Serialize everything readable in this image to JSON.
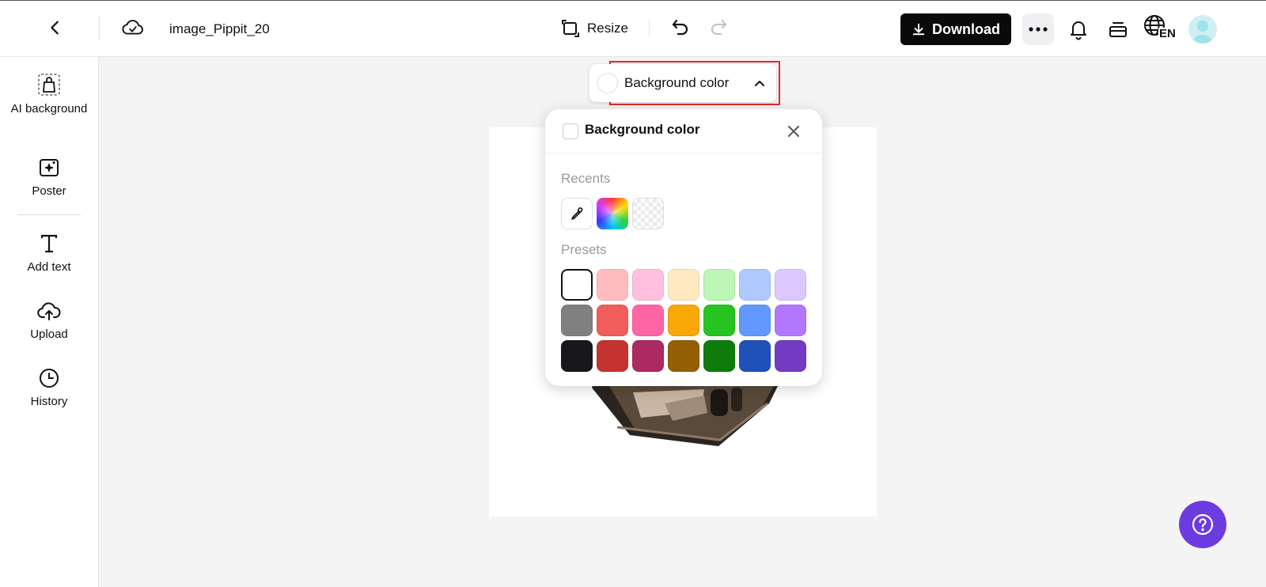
{
  "topbar": {
    "filename": "image_Pippit_20",
    "resize_label": "Resize",
    "download_label": "Download",
    "language_code": "EN"
  },
  "sidebar": {
    "items": [
      {
        "label": "AI background",
        "icon": "bag-icon"
      },
      {
        "label": "Poster",
        "icon": "poster-icon"
      },
      {
        "label": "Add text",
        "icon": "text-icon"
      },
      {
        "label": "Upload",
        "icon": "upload-icon"
      },
      {
        "label": "History",
        "icon": "clock-icon"
      }
    ]
  },
  "bg_trigger": {
    "label": "Background color",
    "current_color": "#ffffff"
  },
  "color_popup": {
    "title": "Background color",
    "recents_label": "Recents",
    "presets_label": "Presets",
    "recents": [
      "eyedropper",
      "custom-gradient",
      "transparent"
    ],
    "presets": [
      [
        "#ffffff",
        "#ffbcbc",
        "#ffc0dd",
        "#ffe9c2",
        "#bcf7b5",
        "#afc8ff",
        "#dcc7ff"
      ],
      [
        "#808080",
        "#f05d5a",
        "#ff65a4",
        "#f8a705",
        "#25c420",
        "#6197ff",
        "#b178ff"
      ],
      [
        "#17171c",
        "#c5332f",
        "#ad2961",
        "#946003",
        "#0e7c0a",
        "#1f51b8",
        "#733bc1"
      ]
    ],
    "selected_preset": "#ffffff"
  },
  "colors": {
    "accent": "#6c3ce0",
    "highlight_outline": "#e02a2a",
    "download_bg": "#0a0a0a"
  }
}
